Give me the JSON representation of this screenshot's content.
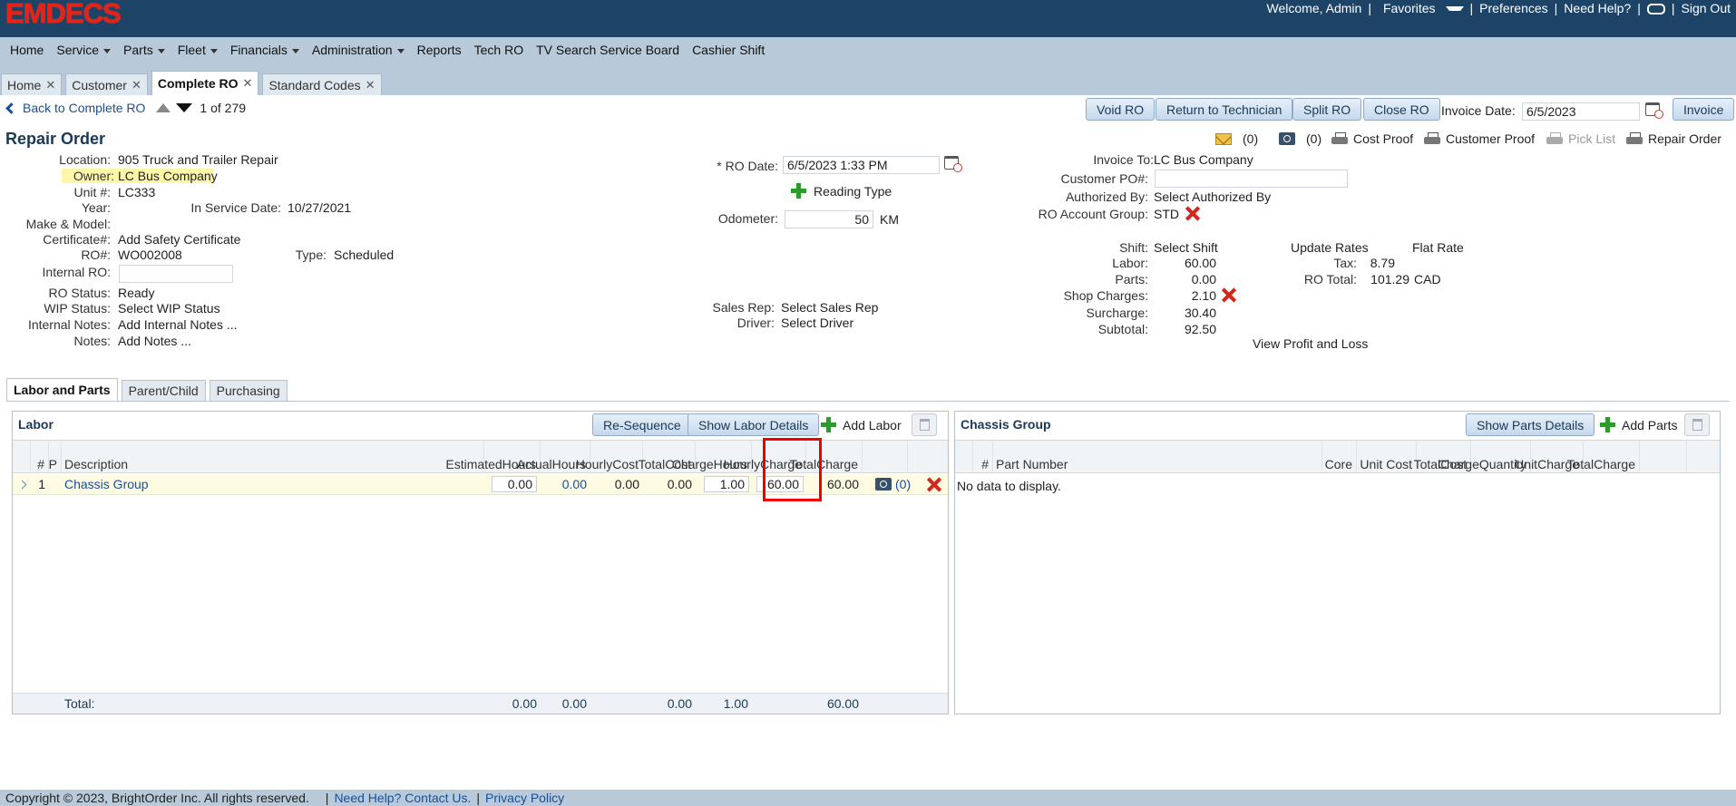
{
  "header": {
    "logo": "EMDECS",
    "welcome": "Welcome, Admin",
    "favorites": "Favorites",
    "preferences": "Preferences",
    "need_help": "Need Help?",
    "sign_out": "Sign Out"
  },
  "nav": {
    "home": "Home",
    "service": "Service",
    "parts": "Parts",
    "fleet": "Fleet",
    "financials": "Financials",
    "administration": "Administration",
    "reports": "Reports",
    "tech_ro": "Tech RO",
    "tv_search": "TV Search Service Board",
    "cashier_shift": "Cashier Shift"
  },
  "tabs": [
    {
      "label": "Home"
    },
    {
      "label": "Customer"
    },
    {
      "label": "Complete RO"
    },
    {
      "label": "Standard Codes"
    }
  ],
  "toolbar": {
    "back": "Back to Complete RO",
    "record_pos": "1",
    "of": "of",
    "record_total": "279",
    "void_ro": "Void RO",
    "return_tech": "Return to Technician",
    "split_ro": "Split RO",
    "close_ro": "Close RO",
    "invoice_date_label": "Invoice Date:",
    "invoice_date": "6/5/2023",
    "invoice": "Invoice"
  },
  "ro": {
    "title": "Repair Order",
    "location_label": "Location:",
    "location": "905 Truck and Trailer Repair",
    "owner_label": "Owner:",
    "owner": "LC Bus Company",
    "unit_label": "Unit #:",
    "unit": "LC333",
    "year_label": "Year:",
    "in_service_label": "In Service Date:",
    "in_service": "10/27/2021",
    "make_model_label": "Make & Model:",
    "certificate_label": "Certificate#:",
    "certificate": "Add Safety Certificate",
    "ro_num_label": "RO#:",
    "ro_num": "WO002008",
    "type_label": "Type:",
    "type": "Scheduled",
    "internal_ro_label": "Internal RO:",
    "ro_status_label": "RO Status:",
    "ro_status": "Ready",
    "wip_label": "WIP Status:",
    "wip": "Select WIP Status",
    "internal_notes_label": "Internal Notes:",
    "internal_notes": "Add Internal Notes ...",
    "notes_label": "Notes:",
    "notes": "Add Notes ...",
    "ro_date_label": "* RO Date:",
    "ro_date": "6/5/2023 1:33 PM",
    "reading_type": "Reading Type",
    "odometer_label": "Odometer:",
    "odometer": "50",
    "odometer_unit": "KM",
    "sales_rep_label": "Sales Rep:",
    "sales_rep": "Select Sales Rep",
    "driver_label": "Driver:",
    "driver": "Select Driver",
    "invoice_to_label": "Invoice To:",
    "invoice_to": "LC Bus Company",
    "customer_po_label": "Customer PO#:",
    "authorized_by_label": "Authorized By:",
    "authorized_by": "Select Authorized By",
    "account_group_label": "RO Account Group:",
    "account_group": "STD",
    "mail_count": "(0)",
    "photo_count": "(0)",
    "cost_proof": "Cost Proof",
    "customer_proof": "Customer Proof",
    "pick_list": "Pick List",
    "repair_order": "Repair Order"
  },
  "totals": {
    "shift_label": "Shift:",
    "shift": "Select Shift",
    "update_rates": "Update Rates",
    "flat_rate": "Flat Rate",
    "labor_label": "Labor:",
    "labor": "60.00",
    "tax_label": "Tax:",
    "tax": "8.79",
    "parts_label": "Parts:",
    "parts": "0.00",
    "ro_total_label": "RO Total:",
    "ro_total": "101.29",
    "currency": "CAD",
    "shop_charges_label": "Shop Charges:",
    "shop_charges": "2.10",
    "surcharge_label": "Surcharge:",
    "surcharge": "30.40",
    "subtotal_label": "Subtotal:",
    "subtotal": "92.50",
    "profit_loss": "View Profit and Loss"
  },
  "subtabs": [
    {
      "label": "Labor and Parts"
    },
    {
      "label": "Parent/Child"
    },
    {
      "label": "Purchasing"
    }
  ],
  "labor": {
    "title": "Labor",
    "resequence": "Re-Sequence",
    "show_details": "Show Labor Details",
    "add_labor": "Add Labor",
    "columns": {
      "num": "#",
      "p": "P",
      "description": "Description",
      "est_hours": [
        "Estimated",
        "Hours"
      ],
      "act_hours": [
        "Actual",
        "Hours"
      ],
      "hourly_cost": [
        "Hourly",
        "Cost"
      ],
      "total_cost": [
        "Total",
        "Cost"
      ],
      "charge_hours": [
        "Charge",
        "Hours"
      ],
      "hourly_charge": [
        "Hourly",
        "Charge"
      ],
      "total_charge": [
        "Total",
        "Charge"
      ]
    },
    "rows": [
      {
        "num": "1",
        "description": "Chassis Group",
        "est_hours": "0.00",
        "act_hours": "0.00",
        "hourly_cost": "0.00",
        "total_cost": "0.00",
        "charge_hours": "1.00",
        "hourly_charge": "60.00",
        "total_charge": "60.00",
        "photo_count": "(0)"
      }
    ],
    "total_label": "Total:",
    "total": {
      "est_hours": "0.00",
      "act_hours": "0.00",
      "total_cost": "0.00",
      "charge_hours": "1.00",
      "total_charge": "60.00"
    }
  },
  "parts": {
    "title": "Chassis Group",
    "show_details": "Show Parts Details",
    "add_parts": "Add Parts",
    "columns": {
      "num": "#",
      "part_number": "Part Number",
      "core": "Core",
      "unit_cost": "Unit Cost",
      "total_cost": [
        "Total",
        "Cost"
      ],
      "charge_qty": [
        "Charge",
        "Quantity"
      ],
      "unit_charge": [
        "Unit",
        "Charge"
      ],
      "total_charge": [
        "Total",
        "Charge"
      ]
    },
    "empty": "No data to display."
  },
  "footer": {
    "copyright": "Copyright © 2023, BrightOrder Inc. All rights reserved.",
    "help": "Need Help? Contact Us.",
    "privacy": "Privacy Policy"
  }
}
